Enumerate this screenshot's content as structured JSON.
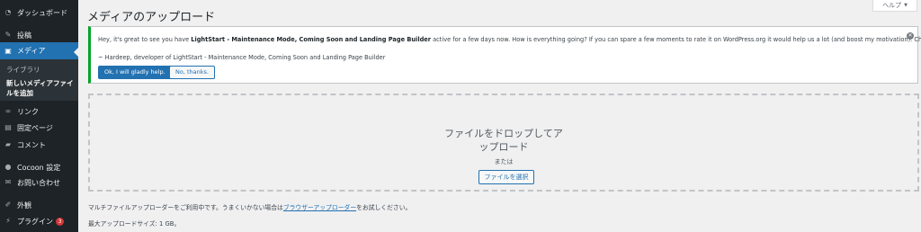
{
  "sidebar": {
    "items": [
      {
        "id": "dashboard",
        "label": "ダッシュボード",
        "icon": "dashboard-icon"
      },
      {
        "id": "posts",
        "label": "投稿",
        "icon": "pin-icon"
      },
      {
        "id": "media",
        "label": "メディア",
        "icon": "media-icon"
      },
      {
        "id": "links",
        "label": "リンク",
        "icon": "link-icon"
      },
      {
        "id": "pages",
        "label": "固定ページ",
        "icon": "page-icon"
      },
      {
        "id": "comments",
        "label": "コメント",
        "icon": "comment-icon"
      },
      {
        "id": "cocoon",
        "label": "Cocoon 設定",
        "icon": "cocoon-icon"
      },
      {
        "id": "contact",
        "label": "お問い合わせ",
        "icon": "mail-icon"
      },
      {
        "id": "appearance",
        "label": "外観",
        "icon": "brush-icon"
      },
      {
        "id": "plugins",
        "label": "プラグイン",
        "icon": "plugin-icon",
        "badge": "3"
      }
    ],
    "media_submenu": {
      "library": "ライブラリ",
      "add_new_line1": "新しいメディアファイ",
      "add_new_line2": "ルを追加"
    }
  },
  "header": {
    "title": "メディアのアップロード",
    "help_label": "ヘルプ"
  },
  "notice": {
    "text_before": "Hey, it's great to see you have ",
    "plugin_name": "LightStart - Maintenance Mode, Coming Soon and Landing Page Builder",
    "text_after": " active for a few days now. How is everything going? If you can spare a few moments to rate it on WordPress.org it would help us a lot (and boost my motivation). Cheers!",
    "signature": "~ Hardeep, developer of LightStart - Maintenance Mode, Coming Soon and Landing Page Builder",
    "primary_button": "Ok, I will gladly help.",
    "secondary_button": "No, thanks."
  },
  "uploader": {
    "drop_line1": "ファイルをドロップしてア",
    "drop_line2": "ップロード",
    "or_text": "または",
    "select_button": "ファイルを選択",
    "browser_text_before": "マルチファイルアップローダーをご利用中です。うまくいかない場合は",
    "browser_link": "ブラウザーアップローダー",
    "browser_text_after": "をお試しください。",
    "max_size_label": "最大アップロードサイズ: ",
    "max_size_value": "1 GB",
    "max_size_end": "。"
  },
  "colors": {
    "sidebar_bg": "#1d2327",
    "accent": "#2271b1",
    "notice_border": "#00a32a",
    "badge": "#d63638"
  }
}
